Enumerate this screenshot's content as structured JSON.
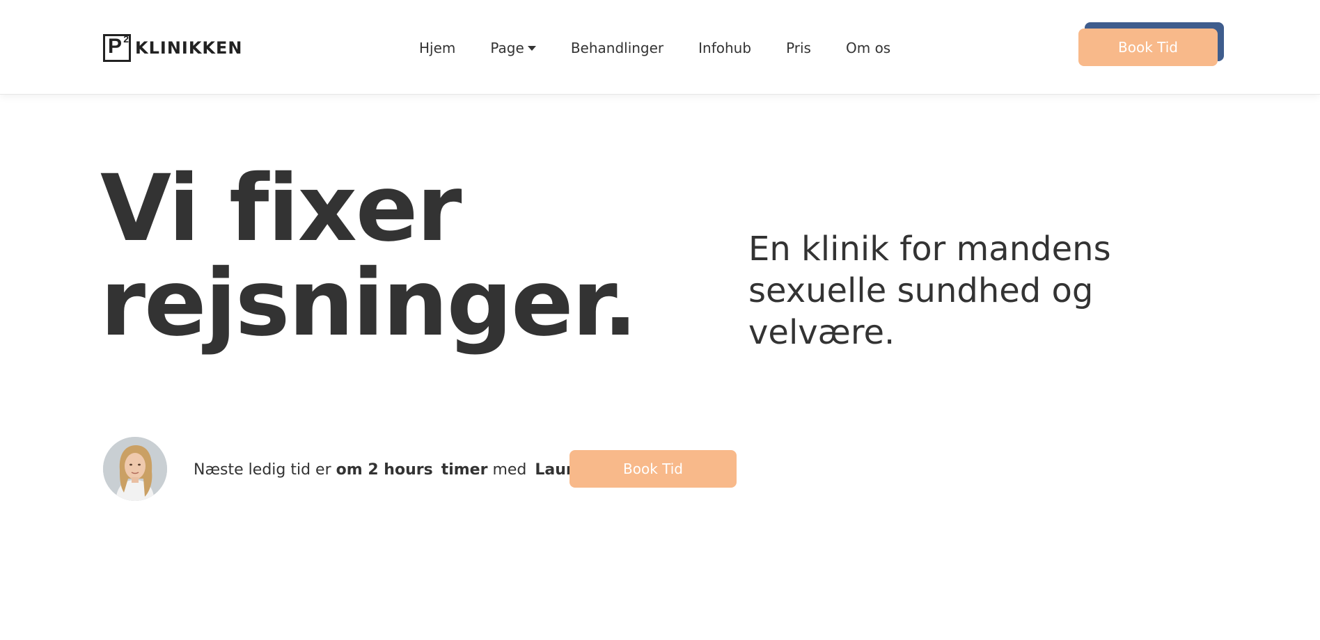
{
  "brand": {
    "logo_letter": "P",
    "logo_superscript": "2",
    "name": "KLINIKKEN"
  },
  "nav": {
    "items": [
      {
        "label": "Hjem"
      },
      {
        "label": "Page",
        "has_dropdown": true
      },
      {
        "label": "Behandlinger"
      },
      {
        "label": "Infohub"
      },
      {
        "label": "Pris"
      },
      {
        "label": "Om os"
      }
    ],
    "cta_label": "Book Tid"
  },
  "hero": {
    "title_line1": "Vi fixer",
    "title_line2": "rejsninger.",
    "subtitle": "En klinik for mandens sexuelle sundhed og velvære."
  },
  "availability": {
    "prefix": "Næste ledig tid er",
    "time": "om 2 hours",
    "unit": "timer",
    "with": "med",
    "person": "Laura",
    "button_label": "Book Tid"
  },
  "colors": {
    "accent": "#f8b98a",
    "accent_shadow": "#3f5d8d",
    "text": "#333333",
    "background": "#ffffff"
  }
}
